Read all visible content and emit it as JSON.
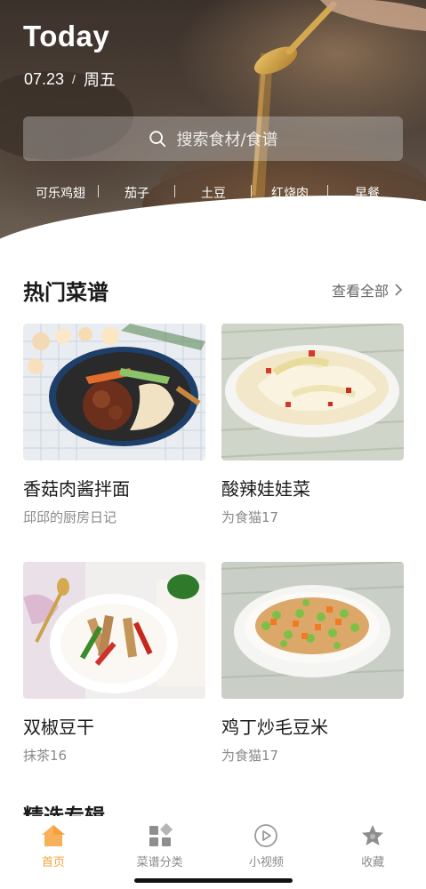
{
  "hero": {
    "title": "Today",
    "date": "07.23",
    "date_sep": "/",
    "weekday": "周五",
    "search_placeholder": "搜索食材/食谱",
    "hot_tags": [
      "可乐鸡翅",
      "茄子",
      "土豆",
      "红烧肉",
      "早餐"
    ]
  },
  "popular": {
    "title": "热门菜谱",
    "view_all": "查看全部",
    "recipes": [
      {
        "name": "香菇肉酱拌面",
        "author": "邱邱的厨房日记"
      },
      {
        "name": "酸辣娃娃菜",
        "author": "为食猫17"
      },
      {
        "name": "双椒豆干",
        "author": "抹茶16"
      },
      {
        "name": "鸡丁炒毛豆米",
        "author": "为食猫17"
      }
    ]
  },
  "featured": {
    "title": "精选专辑"
  },
  "bottom_nav": {
    "items": [
      {
        "label": "首页",
        "icon": "home-icon",
        "active": true
      },
      {
        "label": "菜谱分类",
        "icon": "category-grid-icon",
        "active": false
      },
      {
        "label": "小视频",
        "icon": "video-play-icon",
        "active": false
      },
      {
        "label": "收藏",
        "icon": "star-icon",
        "active": false
      }
    ]
  },
  "colors": {
    "accent": "#f2a23a",
    "nav_inactive": "#8a8a8a",
    "text_primary": "#1a1a1a",
    "text_secondary": "#8a8a8a"
  }
}
